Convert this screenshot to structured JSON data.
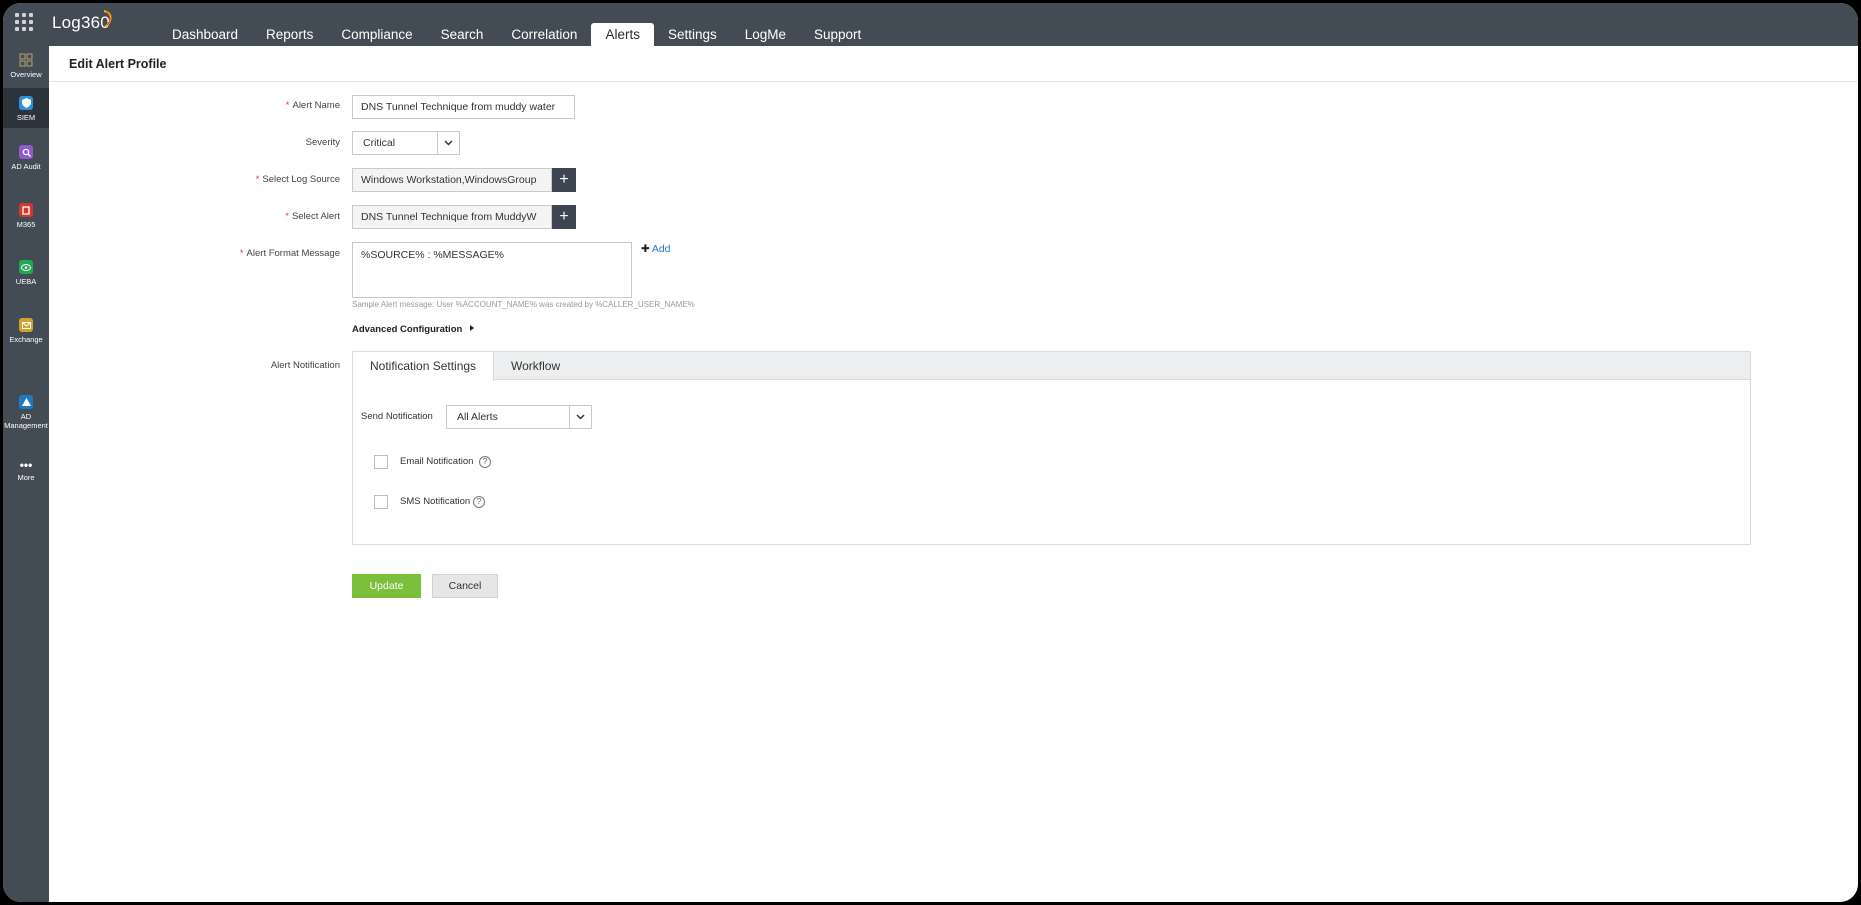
{
  "app": {
    "logo": "Log360"
  },
  "nav": {
    "tabs": [
      {
        "label": "Dashboard"
      },
      {
        "label": "Reports"
      },
      {
        "label": "Compliance"
      },
      {
        "label": "Search"
      },
      {
        "label": "Correlation"
      },
      {
        "label": "Alerts"
      },
      {
        "label": "Settings"
      },
      {
        "label": "LogMe"
      },
      {
        "label": "Support"
      }
    ],
    "active": "Alerts"
  },
  "sidebar": {
    "items": [
      {
        "label": "Overview",
        "icon": "grid-icon",
        "color": "#9aa2ab"
      },
      {
        "label": "SIEM",
        "icon": "shield-icon",
        "color": "#2f8fd8"
      },
      {
        "label": "AD Audit",
        "icon": "search-icon",
        "color": "#8e5bd0"
      },
      {
        "label": "M365",
        "icon": "office-icon",
        "color": "#d3382f"
      },
      {
        "label": "UEBA",
        "icon": "eye-icon",
        "color": "#23a855"
      },
      {
        "label": "Exchange",
        "icon": "mail-icon",
        "color": "#d1a22e"
      },
      {
        "label": "AD",
        "label2": "Management",
        "icon": "person-icon",
        "color": "#1f7bc1"
      },
      {
        "label": "More",
        "icon": "more-icon",
        "color": "#ffffff"
      }
    ]
  },
  "page": {
    "title": "Edit Alert Profile"
  },
  "form": {
    "alert_name": {
      "label": "Alert Name",
      "value": "DNS Tunnel Technique from muddy water"
    },
    "severity": {
      "label": "Severity",
      "value": "Critical"
    },
    "log_source": {
      "label": "Select Log Source",
      "value": "Windows Workstation,WindowsGroup"
    },
    "select_alert": {
      "label": "Select Alert",
      "value": "DNS Tunnel Technique from MuddyW"
    },
    "format_message": {
      "label": "Alert Format Message",
      "value": "%SOURCE% : %MESSAGE%",
      "add": "Add"
    },
    "sample_hint": "Sample Alert message: User %ACCOUNT_NAME% was created by %CALLER_USER_NAME%",
    "advanced": "Advanced Configuration",
    "notification_label": "Alert Notification"
  },
  "notification": {
    "tabs": [
      {
        "label": "Notification Settings"
      },
      {
        "label": "Workflow"
      }
    ],
    "send_label": "Send Notification",
    "send_value": "All Alerts",
    "email": "Email Notification",
    "sms": "SMS Notification",
    "help": "?"
  },
  "buttons": {
    "update": "Update",
    "cancel": "Cancel"
  },
  "colors": {
    "topbar": "#434b55",
    "update": "#7cbf3d",
    "link": "#2a79c4"
  }
}
